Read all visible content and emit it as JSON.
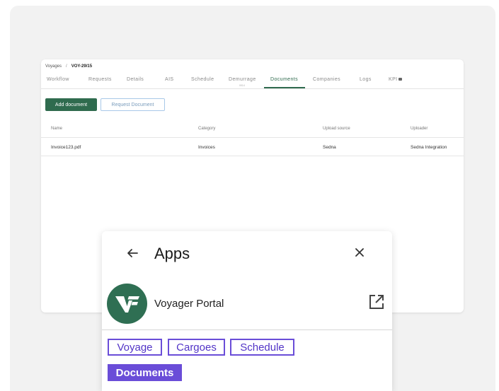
{
  "portal": {
    "breadcrumb": {
      "root": "Voyages",
      "separator": "/",
      "current": "VOY-29/15"
    },
    "tabs": [
      {
        "label": "Workflow"
      },
      {
        "label": "Requests"
      },
      {
        "label": "Details"
      },
      {
        "label": "AIS"
      },
      {
        "label": "Schedule"
      },
      {
        "label": "Demurrage"
      },
      {
        "label": "Documents",
        "active": true
      },
      {
        "label": "Companies"
      },
      {
        "label": "Logs"
      },
      {
        "label": "KPI"
      }
    ],
    "tab_sublabel": "0014",
    "add_document_label": "Add document",
    "request_document_label": "Request Document",
    "table": {
      "headers": [
        "Name",
        "Category",
        "Upload source",
        "Uploader"
      ],
      "rows": [
        [
          "Invoice123.pdf",
          "Invoices",
          "Sedna",
          "Sedna Integration"
        ]
      ]
    }
  },
  "apps": {
    "title": "Apps",
    "back_icon": "arrow-left-icon",
    "close_icon": "close-icon",
    "item": {
      "name": "Voyager Portal",
      "logo": "voyager-logo",
      "open_icon": "external-link-icon"
    },
    "chips": [
      {
        "label": "Voyage",
        "selected": false
      },
      {
        "label": "Cargoes",
        "selected": false
      },
      {
        "label": "Schedule",
        "selected": false
      },
      {
        "label": "Documents",
        "selected": true
      }
    ]
  },
  "colors": {
    "brand_green": "#2f6b4e",
    "accent_purple": "#6a4dd8",
    "background": "#f2f2f2"
  }
}
